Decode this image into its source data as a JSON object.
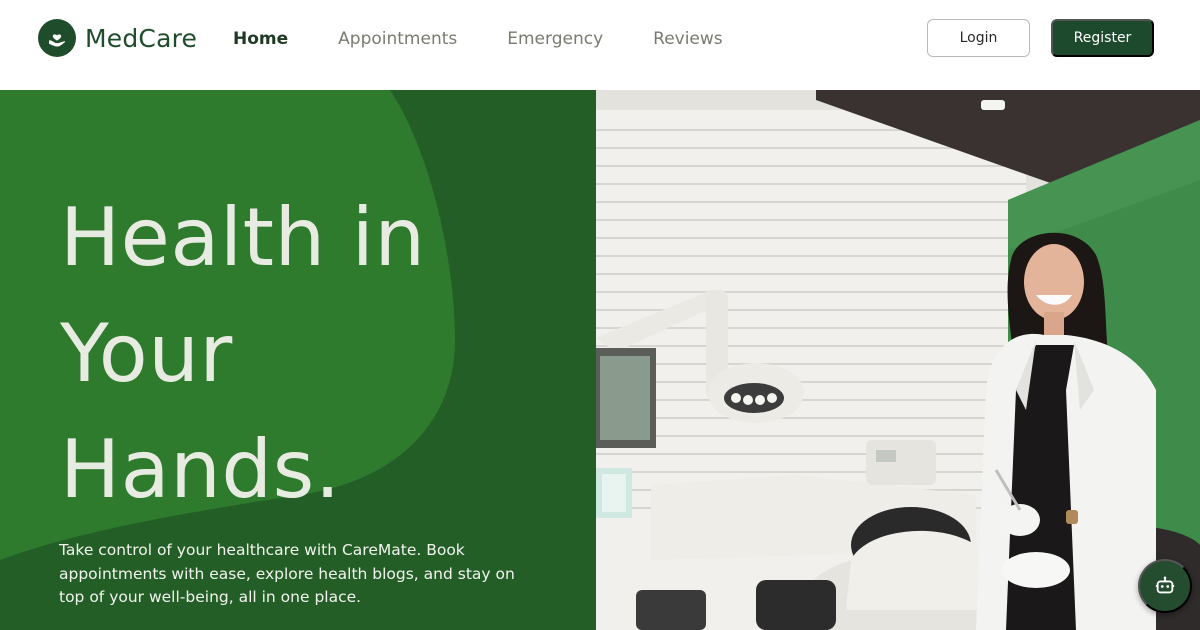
{
  "brand": {
    "name": "MedCare",
    "icon": "heart-in-hand-icon"
  },
  "nav": {
    "links": [
      {
        "label": "Home",
        "active": true
      },
      {
        "label": "Appointments",
        "active": false
      },
      {
        "label": "Emergency",
        "active": false
      },
      {
        "label": "Reviews",
        "active": false
      }
    ],
    "login_label": "Login",
    "register_label": "Register"
  },
  "hero": {
    "title_lines": [
      "Health in",
      "Your",
      "Hands."
    ],
    "description": "Take control of your healthcare with CareMate. Book appointments with ease, explore health blogs, and stay on top of your well-being, all in one place.",
    "image_alt": "Smiling dentist in a white coat standing beside a patient in a dental chair"
  },
  "chatbot": {
    "icon": "robot-icon"
  },
  "colors": {
    "brand_green": "#1f4d2b",
    "hero_dark_green": "#235e27",
    "hero_light_green": "#2f7b2d",
    "hero_text": "#e8ebe2",
    "nav_muted": "#7a7a6e"
  }
}
